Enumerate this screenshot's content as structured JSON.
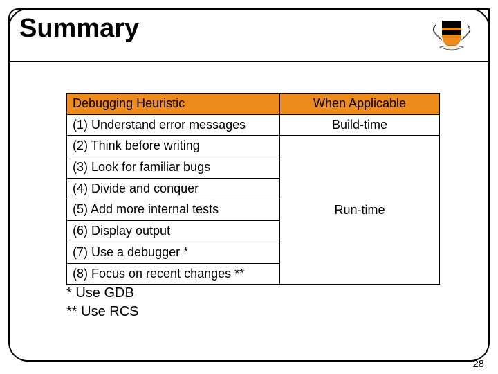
{
  "title": "Summary",
  "logo_name": "princeton-crest",
  "table": {
    "headers": {
      "heuristic": "Debugging Heuristic",
      "when": "When Applicable"
    },
    "build": {
      "heuristic": "(1) Understand error messages",
      "when": "Build-time"
    },
    "run": {
      "heuristics": [
        "(2) Think before writing",
        "(3) Look for familiar bugs",
        "(4) Divide and conquer",
        "(5) Add more internal tests",
        "(6) Display output",
        "(7) Use a debugger *",
        "(8) Focus on recent changes **"
      ],
      "when": "Run-time"
    }
  },
  "footnotes": {
    "f1": "* Use GDB",
    "f2": "** Use RCS"
  },
  "page_number": "28"
}
